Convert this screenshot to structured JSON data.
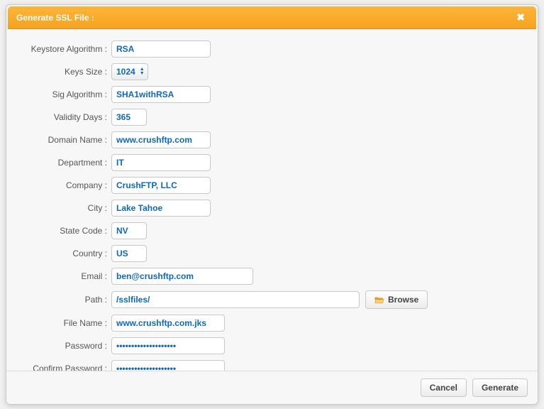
{
  "modal": {
    "title": "Generate SSL File :",
    "close_symbol": "✖"
  },
  "labels": {
    "keystore_algorithm": "Keystore Algorithm :",
    "keys_size": "Keys Size :",
    "sig_algorithm": "Sig Algorithm :",
    "validity_days": "Validity Days :",
    "domain_name": "Domain Name :",
    "department": "Department :",
    "company": "Company :",
    "city": "City :",
    "state_code": "State Code :",
    "country": "Country :",
    "email": "Email :",
    "path": "Path :",
    "file_name": "File Name :",
    "password": "Password :",
    "confirm_password": "Confirm Password :"
  },
  "values": {
    "keystore_algorithm": "RSA",
    "keys_size": "1024",
    "sig_algorithm": "SHA1withRSA",
    "validity_days": "365",
    "domain_name": "www.crushftp.com",
    "department": "IT",
    "company": "CrushFTP, LLC",
    "city": "Lake Tahoe",
    "state_code": "NV",
    "country": "US",
    "email": "ben@crushftp.com",
    "path": "/sslfiles/",
    "file_name": "www.crushftp.com.jks",
    "password": "••••••••••••••••••••",
    "confirm_password": "••••••••••••••••••••"
  },
  "buttons": {
    "browse": "Browse",
    "cancel": "Cancel",
    "generate": "Generate"
  }
}
